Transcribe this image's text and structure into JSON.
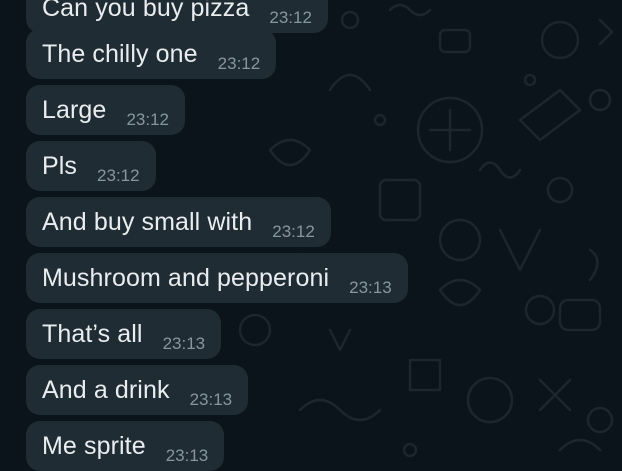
{
  "chat": {
    "messages": [
      {
        "text": "Can you buy pizza",
        "time": "23:12"
      },
      {
        "text": "The chilly one",
        "time": "23:12"
      },
      {
        "text": "Large",
        "time": "23:12"
      },
      {
        "text": "Pls",
        "time": "23:12"
      },
      {
        "text": "And buy small with",
        "time": "23:12"
      },
      {
        "text": "Mushroom and pepperoni",
        "time": "23:13"
      },
      {
        "text": "That’s all",
        "time": "23:13"
      },
      {
        "text": "And a drink",
        "time": "23:13"
      },
      {
        "text": "Me sprite",
        "time": "23:13"
      }
    ]
  },
  "colors": {
    "background": "#0b141a",
    "bubble": "#202c33",
    "message_text": "#e9edef",
    "timestamp": "#8696a0"
  }
}
